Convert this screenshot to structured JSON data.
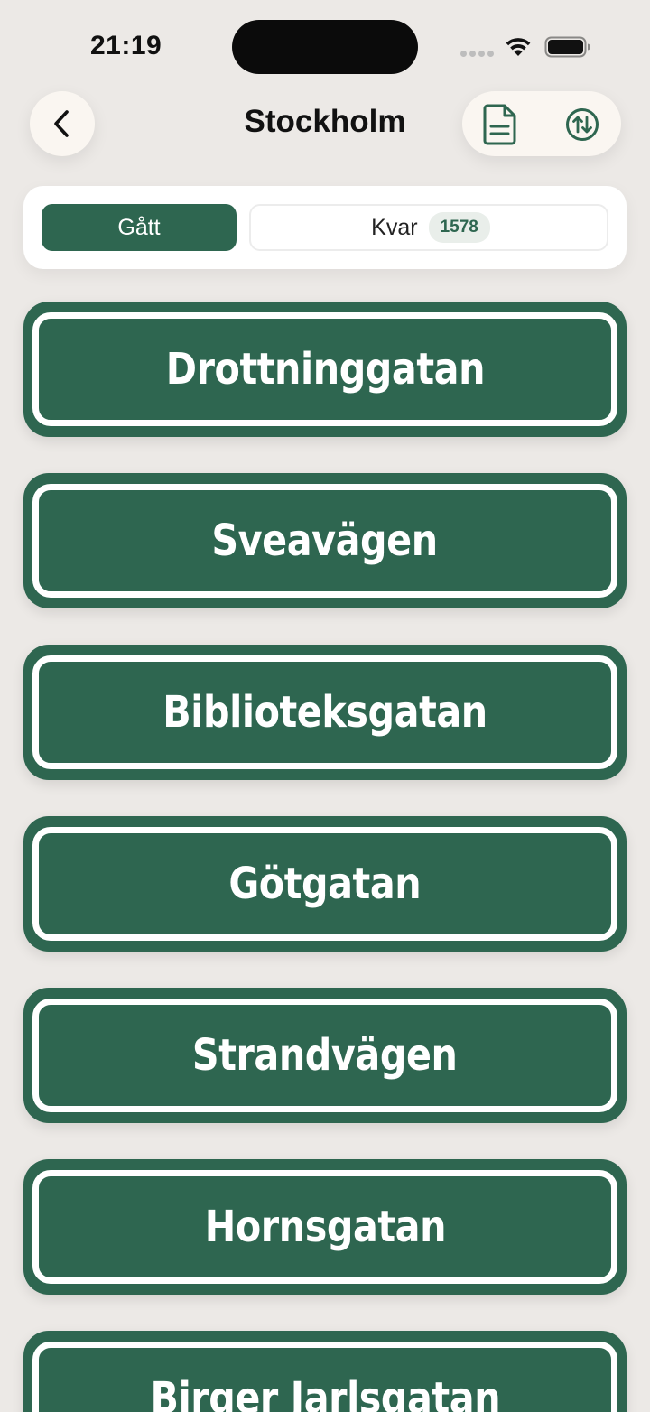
{
  "status_bar": {
    "time": "21:19"
  },
  "nav": {
    "title": "Stockholm",
    "back_icon": "chevron-left-icon",
    "document_icon": "document-icon",
    "sort_icon": "sort-arrows-icon"
  },
  "segments": {
    "visited_label": "Gått",
    "remaining_label": "Kvar",
    "remaining_count": "1578"
  },
  "streets": [
    "Drottninggatan",
    "Sveavägen",
    "Biblioteksgatan",
    "Götgatan",
    "Strandvägen",
    "Hornsgatan",
    "Birger Jarlsgatan"
  ],
  "colors": {
    "accent_green": "#2E6650",
    "background": "#ECE9E6",
    "button_surface": "#FAF6F1"
  }
}
